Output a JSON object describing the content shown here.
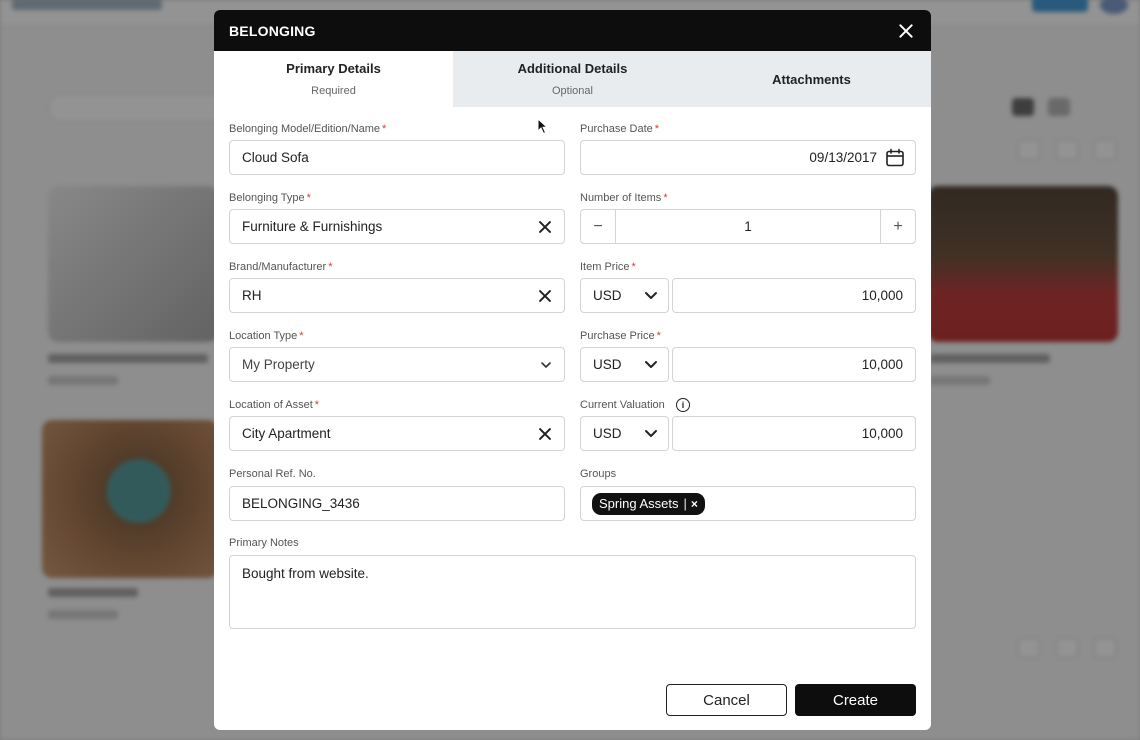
{
  "modal": {
    "title": "BELONGING",
    "tabs": [
      {
        "label": "Primary Details",
        "sub": "Required"
      },
      {
        "label": "Additional Details",
        "sub": "Optional"
      },
      {
        "label": "Attachments",
        "sub": ""
      }
    ]
  },
  "form": {
    "model": {
      "label": "Belonging Model/Edition/Name",
      "value": "Cloud Sofa"
    },
    "purchase_date": {
      "label": "Purchase Date",
      "value": "09/13/2017"
    },
    "type": {
      "label": "Belonging Type",
      "value": "Furniture & Furnishings"
    },
    "items": {
      "label": "Number of Items",
      "value": "1",
      "minus": "−",
      "plus": "+"
    },
    "brand": {
      "label": "Brand/Manufacturer",
      "value": "RH"
    },
    "item_price": {
      "label": "Item Price",
      "currency": "USD",
      "value": "10,000"
    },
    "location_type": {
      "label": "Location Type",
      "value": "My Property"
    },
    "purchase_price": {
      "label": "Purchase Price",
      "currency": "USD",
      "value": "10,000"
    },
    "location_asset": {
      "label": "Location of Asset",
      "value": "City Apartment"
    },
    "current_valuation": {
      "label": "Current Valuation",
      "currency": "USD",
      "value": "10,000"
    },
    "personal_ref": {
      "label": "Personal Ref. No.",
      "value": "BELONGING_3436"
    },
    "groups": {
      "label": "Groups",
      "chip": "Spring Assets"
    },
    "notes": {
      "label": "Primary Notes",
      "value": "Bought from website."
    },
    "required_mark": "*",
    "info_glyph": "i"
  },
  "actions": {
    "cancel": "Cancel",
    "create": "Create"
  }
}
